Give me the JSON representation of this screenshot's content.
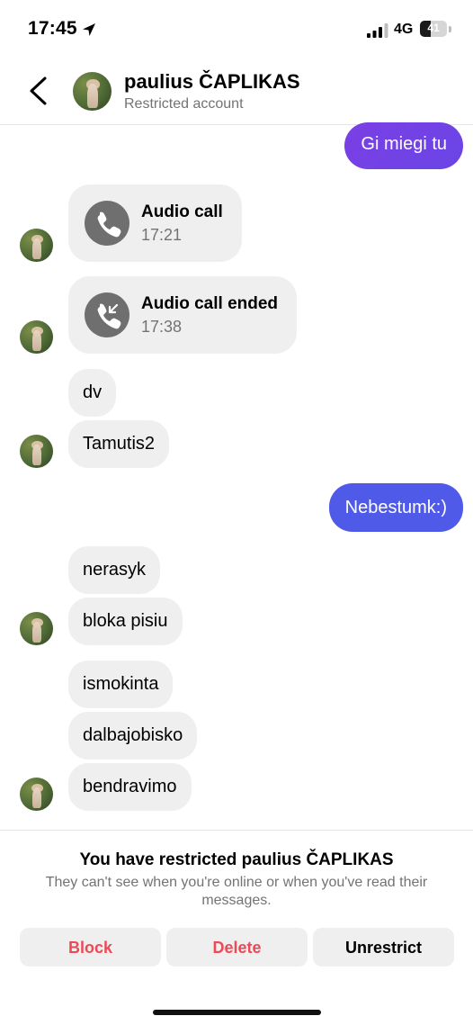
{
  "status_bar": {
    "time": "17:45",
    "network": "4G",
    "battery": "41",
    "battery_level": 0.41,
    "location_icon": "location-arrow-icon",
    "signal_icon": "signal-bars-icon"
  },
  "header": {
    "name": "paulius ČAPLIKAS",
    "subtitle": "Restricted account",
    "back_icon": "chevron-left-icon"
  },
  "messages": [
    {
      "side": "out",
      "text": "Gi miegi tu"
    },
    {
      "side": "in",
      "type": "call",
      "title": "Audio call",
      "time": "17:21",
      "icon": "phone-icon"
    },
    {
      "side": "in",
      "type": "call",
      "title": "Audio call ended",
      "time": "17:38",
      "icon": "call-ended-icon"
    },
    {
      "side": "in",
      "text": "dv"
    },
    {
      "side": "in",
      "text": "Tamutis2"
    },
    {
      "side": "out",
      "text": "Nebestumk:)"
    },
    {
      "side": "in",
      "text": "nerasyk"
    },
    {
      "side": "in",
      "text": "bloka pisiu"
    },
    {
      "side": "in",
      "text": "ismokinta"
    },
    {
      "side": "in",
      "text": "dalbajobisko"
    },
    {
      "side": "in",
      "text": "bendravimo"
    }
  ],
  "restricted_panel": {
    "title": "You have restricted paulius ČAPLIKAS",
    "description": "They can't see when you're online or when you've read their messages.",
    "buttons": {
      "block": "Block",
      "delete": "Delete",
      "unrestrict": "Unrestrict"
    }
  },
  "colors": {
    "outgoing_bubble_top": "#7b3fe4",
    "outgoing_bubble_bottom": "#4f5be8",
    "incoming_bubble": "#efefef",
    "destructive": "#ed4956",
    "muted_text": "#737373"
  }
}
